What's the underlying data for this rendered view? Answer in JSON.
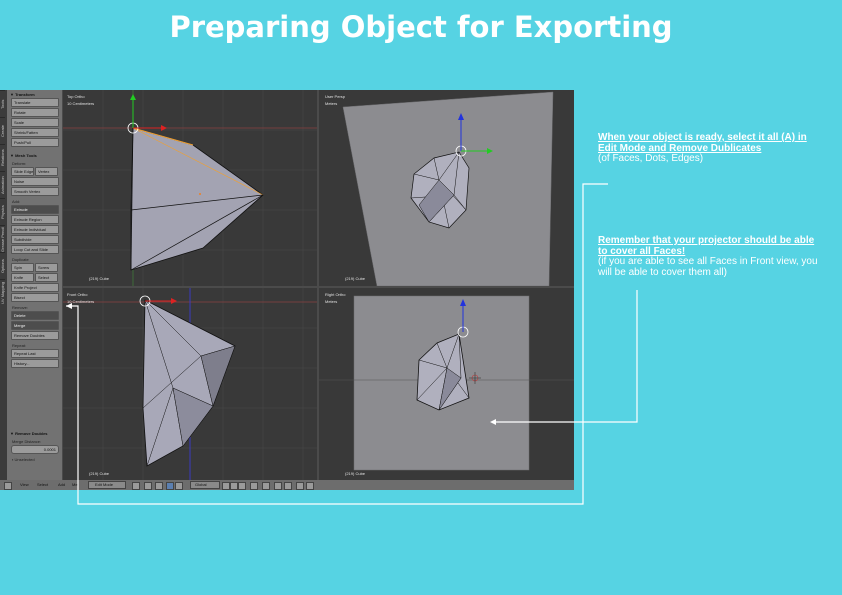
{
  "page": {
    "title": "Preparing Object for Exporting"
  },
  "tool_tabs": [
    "Tools",
    "Create",
    "Relations",
    "Animation",
    "Physics",
    "Grease Pencil",
    "Options",
    "UV Mapping"
  ],
  "tool_shelf": {
    "transform_header": "▼ Transform",
    "transform_buttons": [
      "Translate",
      "Rotate",
      "Scale",
      "Shrink/Fatten",
      "Push/Pull"
    ],
    "mesh_tools_header": "▼ Mesh Tools",
    "deform_label": "Deform:",
    "slide_edge": "Slide Edge",
    "vertex": "Vertex",
    "noise": "Noise",
    "smooth_vertex": "Smooth Vertex",
    "add_label": "Add:",
    "extrude": "Extrude",
    "extrude_region": "Extrude Region",
    "extrude_individual": "Extrude Individual",
    "subdivide": "Subdivide",
    "loop_cut": "Loop Cut and Slide",
    "duplicate": "Duplicate",
    "spin": "Spin",
    "screw": "Screw",
    "knife": "Knife",
    "select": "Select",
    "knife_project": "Knife Project",
    "bisect": "Bisect",
    "remove_label": "Remove:",
    "delete": "Delete",
    "merge": "Merge",
    "remove_doubles": "Remove Doubles",
    "repeat_label": "Repeat:",
    "repeat_last": "Repeat Last",
    "history": "History...",
    "operator_header": "▼ Remove Doubles",
    "merge_distance_label": "Merge Distance:",
    "merge_distance_value": "0.0001",
    "unselected": "Unselected"
  },
  "viewports": [
    {
      "name": "Top Ortho",
      "sub": "10 Centimeters",
      "footer": "(219) Cube"
    },
    {
      "name": "User Persp",
      "sub": "Meters",
      "footer": "(219) Cube"
    },
    {
      "name": "Front Ortho",
      "sub": "10 Centimeters",
      "footer": "(219) Cube"
    },
    {
      "name": "Right Ortho",
      "sub": "Meters",
      "footer": "(219) Cube"
    }
  ],
  "header_bar": {
    "view": "View",
    "select": "Select",
    "add": "Add",
    "mesh": "Me",
    "mode": "Edit Mode",
    "pivot": "Global"
  },
  "notes": {
    "note1": {
      "title": "When your object is ready, select it all (A) in Edit Mode and Remove Dublicates",
      "body": "(of Faces, Dots, Edges)"
    },
    "note2": {
      "title": "Remember that your projector should be able to cover all Faces!",
      "body": "(if you are able to see all Faces in Front view, you will be able to cover them all)"
    }
  },
  "colors": {
    "background": "#56d3e3",
    "arrow": "#ffffff",
    "mesh_face": "#a6a6b4",
    "mesh_edge": "#111111",
    "selected_edge": "#f0a030"
  }
}
